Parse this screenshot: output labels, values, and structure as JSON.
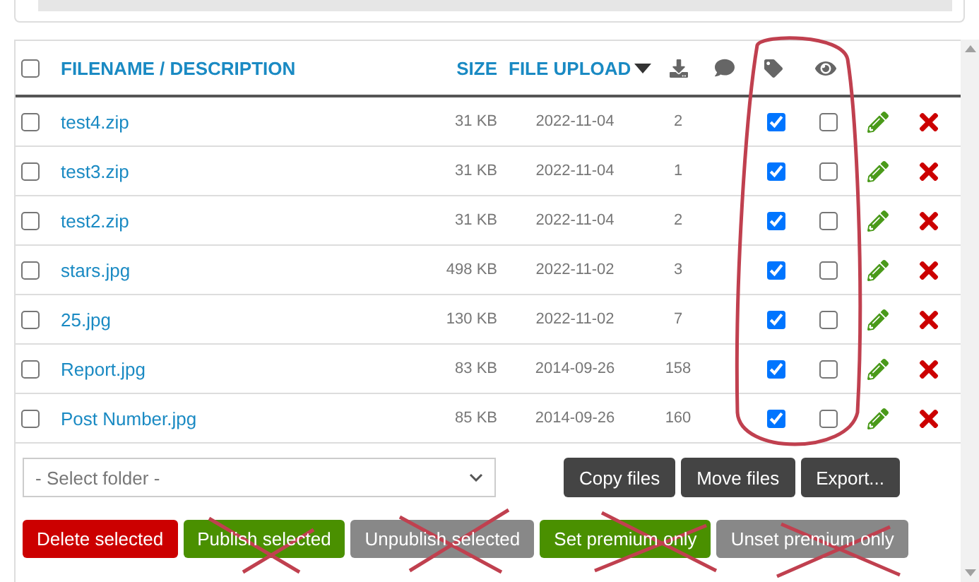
{
  "table": {
    "select_all": {
      "checked": false
    },
    "columns": [
      {
        "label": "FILENAME / DESCRIPTION",
        "sorted": false
      },
      {
        "label": "SIZE",
        "sorted": false
      },
      {
        "label": "FILE UPLOAD",
        "sorted": true
      }
    ],
    "rows": [
      {
        "filename": "test4.zip",
        "size": "31 KB",
        "date": "2022-11-04",
        "downloads": "2",
        "selected": false,
        "premium": true,
        "visible": false
      },
      {
        "filename": "test3.zip",
        "size": "31 KB",
        "date": "2022-11-04",
        "downloads": "1",
        "selected": false,
        "premium": true,
        "visible": false
      },
      {
        "filename": "test2.zip",
        "size": "31 KB",
        "date": "2022-11-04",
        "downloads": "2",
        "selected": false,
        "premium": true,
        "visible": false
      },
      {
        "filename": "stars.jpg",
        "size": "498 KB",
        "date": "2022-11-02",
        "downloads": "3",
        "selected": false,
        "premium": true,
        "visible": false
      },
      {
        "filename": "25.jpg",
        "size": "130 KB",
        "date": "2022-11-02",
        "downloads": "7",
        "selected": false,
        "premium": true,
        "visible": false
      },
      {
        "filename": "Report.jpg",
        "size": "83 KB",
        "date": "2014-09-26",
        "downloads": "158",
        "selected": false,
        "premium": true,
        "visible": false
      },
      {
        "filename": "Post Number.jpg",
        "size": "85 KB",
        "date": "2014-09-26",
        "downloads": "160",
        "selected": false,
        "premium": true,
        "visible": false
      }
    ]
  },
  "folder_select": {
    "placeholder": "- Select folder -"
  },
  "file_actions": [
    "Copy files",
    "Move files",
    "Export..."
  ],
  "bulk_actions": [
    {
      "label": "Delete selected",
      "kind": "danger"
    },
    {
      "label": "Publish selected",
      "kind": "success"
    },
    {
      "label": "Unpublish selected",
      "kind": "neutral"
    },
    {
      "label": "Set premium only",
      "kind": "success"
    },
    {
      "label": "Unset premium only",
      "kind": "neutral"
    }
  ]
}
